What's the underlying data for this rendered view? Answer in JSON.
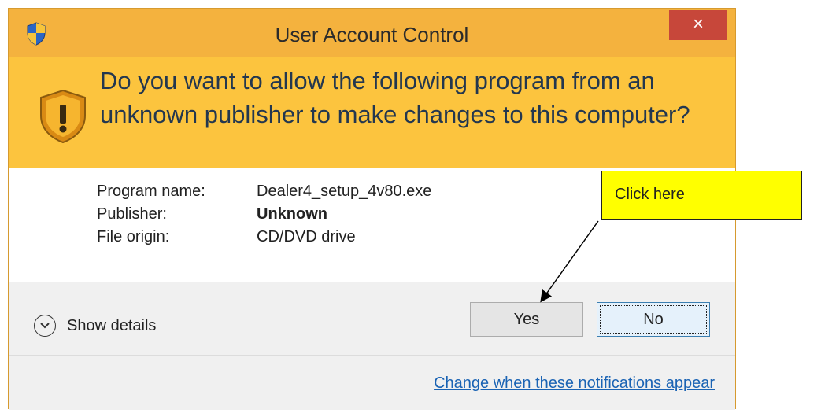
{
  "dialog": {
    "title": "User Account Control",
    "close_label": "×",
    "question": "Do you want to allow the following program from an unknown publisher to make changes to this computer?",
    "program_name_label": "Program name:",
    "program_name": "Dealer4_setup_4v80.exe",
    "publisher_label": "Publisher:",
    "publisher": "Unknown",
    "file_origin_label": "File origin:",
    "file_origin": "CD/DVD drive",
    "show_details_label": "Show details",
    "yes_label": "Yes",
    "no_label": "No",
    "change_link": "Change when these notifications appear"
  },
  "annotation": {
    "callout_text": "Click here"
  },
  "colors": {
    "titlebar": "#f4b23e",
    "header": "#fcc43e",
    "close": "#c7473a",
    "link": "#1a63b4",
    "callout": "#ffff00"
  },
  "icons": [
    "shield-icon",
    "warning-shield-icon",
    "close-icon",
    "chevron-down-icon"
  ]
}
